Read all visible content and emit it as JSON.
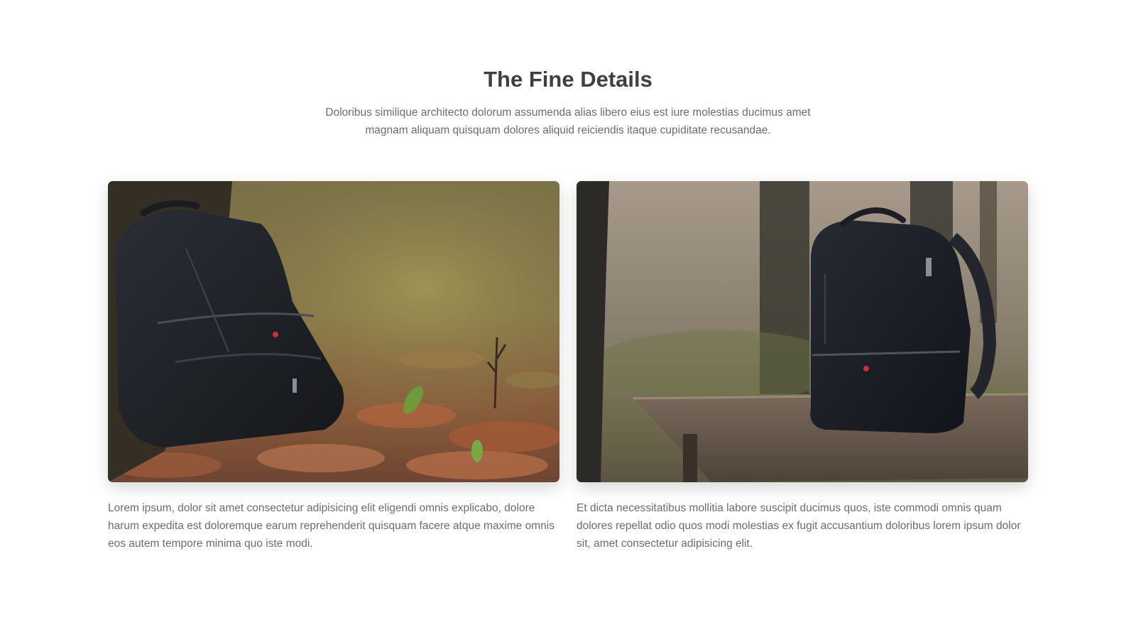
{
  "section": {
    "title": "The Fine Details",
    "lead": "Doloribus similique architecto dolorum assumenda alias libero eius est iure molestias ducimus amet magnam aliquam quisquam dolores aliquid reiciendis itaque cupiditate recusandae."
  },
  "cards": [
    {
      "image_subject": "black backpack leaning against tree on forest floor with autumn leaves",
      "caption": "Lorem ipsum, dolor sit amet consectetur adipisicing elit eligendi omnis explicabo, dolore harum expedita est doloremque earum reprehenderit quisquam facere atque maxime omnis eos autem tempore minima quo iste modi."
    },
    {
      "image_subject": "black backpack standing on wooden bench in forest",
      "caption": "Et dicta necessitatibus mollitia labore suscipit ducimus quos, iste commodi omnis quam dolores repellat odio quos modi molestias ex fugit accusantium doloribus lorem ipsum dolor sit, amet consectetur adipisicing elit."
    }
  ]
}
